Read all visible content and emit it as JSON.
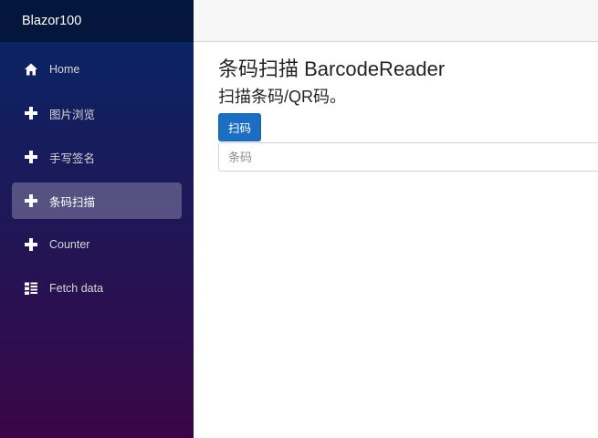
{
  "sidebar": {
    "brand": "Blazor100",
    "items": [
      {
        "label": "Home",
        "icon": "home-icon",
        "active": false
      },
      {
        "label": "图片浏览",
        "icon": "plus-icon",
        "active": false
      },
      {
        "label": "手写签名",
        "icon": "plus-icon",
        "active": false
      },
      {
        "label": "条码扫描",
        "icon": "plus-icon",
        "active": true
      },
      {
        "label": "Counter",
        "icon": "plus-icon",
        "active": false
      },
      {
        "label": "Fetch data",
        "icon": "list-icon",
        "active": false
      }
    ]
  },
  "main": {
    "title": "条码扫描 BarcodeReader",
    "subtitle": "扫描条码/QR码。",
    "scan_button": "扫码",
    "barcode_placeholder": "条码"
  },
  "colors": {
    "sidebar_top": "#052767",
    "sidebar_bottom": "#3a0647",
    "button": "#1b6ec2"
  }
}
